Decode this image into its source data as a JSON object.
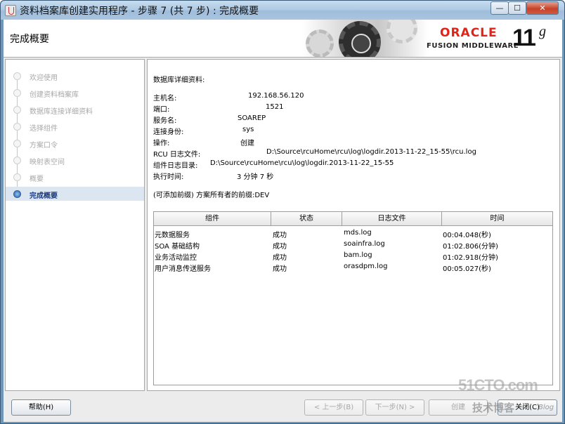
{
  "window": {
    "title": "资料档案库创建实用程序 - 步骤 7 (共 7 步) : 完成概要",
    "minimize": "—",
    "maximize": "☐",
    "close": "✕"
  },
  "header": {
    "title": "完成概要",
    "oracle": "ORACLE",
    "fusion": "FUSION MIDDLEWARE",
    "version_number": "11",
    "version_letter": "g"
  },
  "nav": {
    "items": [
      {
        "label": "欢迎使用",
        "state": "done"
      },
      {
        "label": "创建资料档案库",
        "state": "done"
      },
      {
        "label": "数据库连接详细资料",
        "state": "done"
      },
      {
        "label": "选择组件",
        "state": "done"
      },
      {
        "label": "方案口令",
        "state": "done"
      },
      {
        "label": "映射表空间",
        "state": "done"
      },
      {
        "label": "概要",
        "state": "done"
      },
      {
        "label": "完成概要",
        "state": "active"
      }
    ]
  },
  "details": {
    "heading": "数据库详细资料:",
    "host_label": "主机名:",
    "host_value": "192.168.56.120",
    "port_label": "端口:",
    "port_value": "1521",
    "service_label": "服务名:",
    "service_value": "SOAREP",
    "connect_as_label": "连接身份:",
    "connect_as_value": "sys",
    "operation_label": "操作:",
    "operation_value": "创建",
    "rcu_log_label": "RCU 日志文件:",
    "rcu_log_value": "D:\\Source\\rcuHome\\rcu\\log\\logdir.2013-11-22_15-55\\rcu.log",
    "component_log_label": "组件日志目录:",
    "component_log_value": "D:\\Source\\rcuHome\\rcu\\log\\logdir.2013-11-22_15-55",
    "exec_time_label": "执行时间:",
    "exec_time_value": "3  分钟 7  秒",
    "prefix_note": "(可添加前缀) 方案所有者的前缀:DEV"
  },
  "grid": {
    "columns": [
      "组件",
      "状态",
      "日志文件",
      "时间"
    ],
    "rows": [
      [
        "元数据服务",
        "成功",
        "mds.log",
        "00:04.048(秒)"
      ],
      [
        "SOA 基础结构",
        "成功",
        "soainfra.log",
        "01:02.806(分钟)"
      ],
      [
        "业务活动监控",
        "成功",
        "bam.log",
        "01:02.918(分钟)"
      ],
      [
        "用户消息传送服务",
        "成功",
        "orasdpm.log",
        "00:05.027(秒)"
      ]
    ]
  },
  "buttons": {
    "help": "帮助(H)",
    "back": "< 上一步(B)",
    "next": "下一步(N) >",
    "create": "创建",
    "close": "关闭(C)"
  },
  "watermark": {
    "site": "51CTO.com",
    "tagline": "技术博客",
    "blog": "Blog"
  }
}
